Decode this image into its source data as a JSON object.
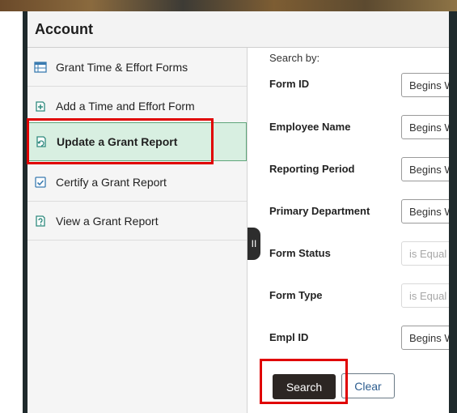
{
  "header": {
    "title": "Account"
  },
  "sidebar": {
    "items": [
      {
        "label": "Grant Time & Effort Forms",
        "icon": "forms-list-icon"
      },
      {
        "label": "Add a Time and Effort Form",
        "icon": "add-form-icon"
      },
      {
        "label": "Update a Grant Report",
        "icon": "update-report-icon",
        "selected": true
      },
      {
        "label": "Certify a Grant Report",
        "icon": "certify-report-icon"
      },
      {
        "label": "View a Grant Report",
        "icon": "view-report-icon"
      }
    ]
  },
  "search": {
    "heading": "Search by:",
    "fields": [
      {
        "label": "Form ID",
        "operator": "Begins With",
        "disabled": false
      },
      {
        "label": "Employee Name",
        "operator": "Begins With",
        "disabled": false
      },
      {
        "label": "Reporting Period",
        "operator": "Begins With",
        "disabled": false
      },
      {
        "label": "Primary Department",
        "operator": "Begins With",
        "disabled": false
      },
      {
        "label": "Form Status",
        "operator": "is Equal To",
        "disabled": true
      },
      {
        "label": "Form Type",
        "operator": "is Equal To",
        "disabled": true
      },
      {
        "label": "Empl ID",
        "operator": "Begins With",
        "disabled": false
      }
    ],
    "search_label": "Search",
    "clear_label": "Clear",
    "toggle_label": "II"
  },
  "colors": {
    "selected_bg": "#d8efe1",
    "highlight": "#e00000",
    "search_button": "#2c2623"
  }
}
